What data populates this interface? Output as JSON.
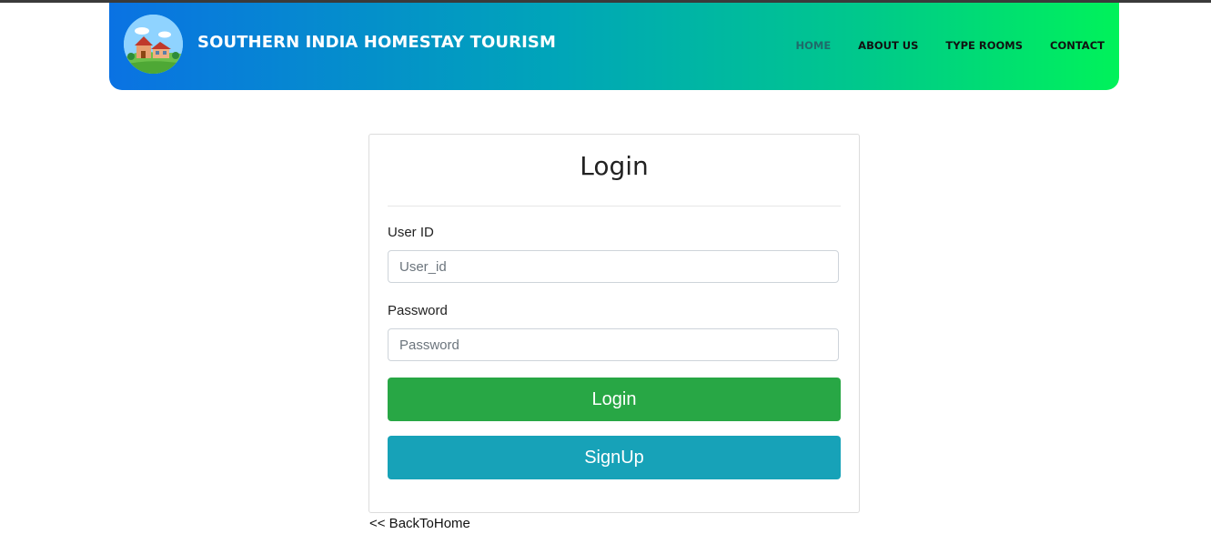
{
  "header": {
    "brand": "SOUTHERN INDIA HOMESTAY TOURISM",
    "logo_icon": "homestay-house-icon",
    "nav": [
      {
        "label": "HOME",
        "active": true
      },
      {
        "label": "ABOUT US",
        "active": false
      },
      {
        "label": "TYPE ROOMS",
        "active": false
      },
      {
        "label": "CONTACT",
        "active": false
      }
    ],
    "colors": {
      "gradient_start": "#0a72e3",
      "gradient_end": "#00f25a"
    }
  },
  "login": {
    "title": "Login",
    "user_id_label": "User ID",
    "user_id_placeholder": "User_id",
    "user_id_value": "",
    "password_label": "Password",
    "password_placeholder": "Password",
    "password_value": "",
    "login_button": "Login",
    "signup_button": "SignUp",
    "colors": {
      "login_button": "#28a745",
      "signup_button": "#17a2b8"
    }
  },
  "back_link": "<< BackToHome"
}
